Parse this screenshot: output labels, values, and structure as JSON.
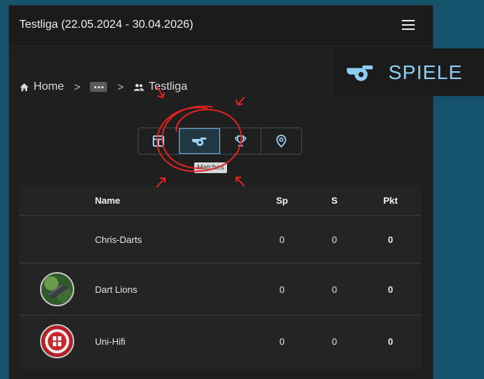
{
  "header": {
    "title": "Testliga (22.05.2024 - 30.04.2026)",
    "menu_icon": "hamburger-menu-icon"
  },
  "breadcrumb": {
    "home_label": "Home",
    "separator": ">",
    "current_label": "Testliga"
  },
  "tabs": [
    {
      "name": "standings",
      "icon": "table-icon",
      "active": false
    },
    {
      "name": "matches",
      "icon": "whistle-icon",
      "active": true
    },
    {
      "name": "trophies",
      "icon": "trophy-icon",
      "active": false
    },
    {
      "name": "locations",
      "icon": "location-pin-icon",
      "active": false
    }
  ],
  "tooltip": {
    "text": "Matches"
  },
  "table": {
    "columns": [
      "Name",
      "Sp",
      "S",
      "Pkt"
    ],
    "rows": [
      {
        "name": "Chris-Darts",
        "sp": "0",
        "s": "0",
        "pkt": "0",
        "avatar": ""
      },
      {
        "name": "Dart Lions",
        "sp": "0",
        "s": "0",
        "pkt": "0",
        "avatar": "team-avatar-green"
      },
      {
        "name": "Uni-Hifi",
        "sp": "0",
        "s": "0",
        "pkt": "0",
        "avatar": "team-avatar-red-crest"
      }
    ]
  },
  "callout": {
    "label": "SPIELE",
    "icon": "whistle-icon"
  },
  "colors": {
    "accent": "#8ecdf3",
    "annotation": "#e0231f",
    "background": "#14536b"
  }
}
